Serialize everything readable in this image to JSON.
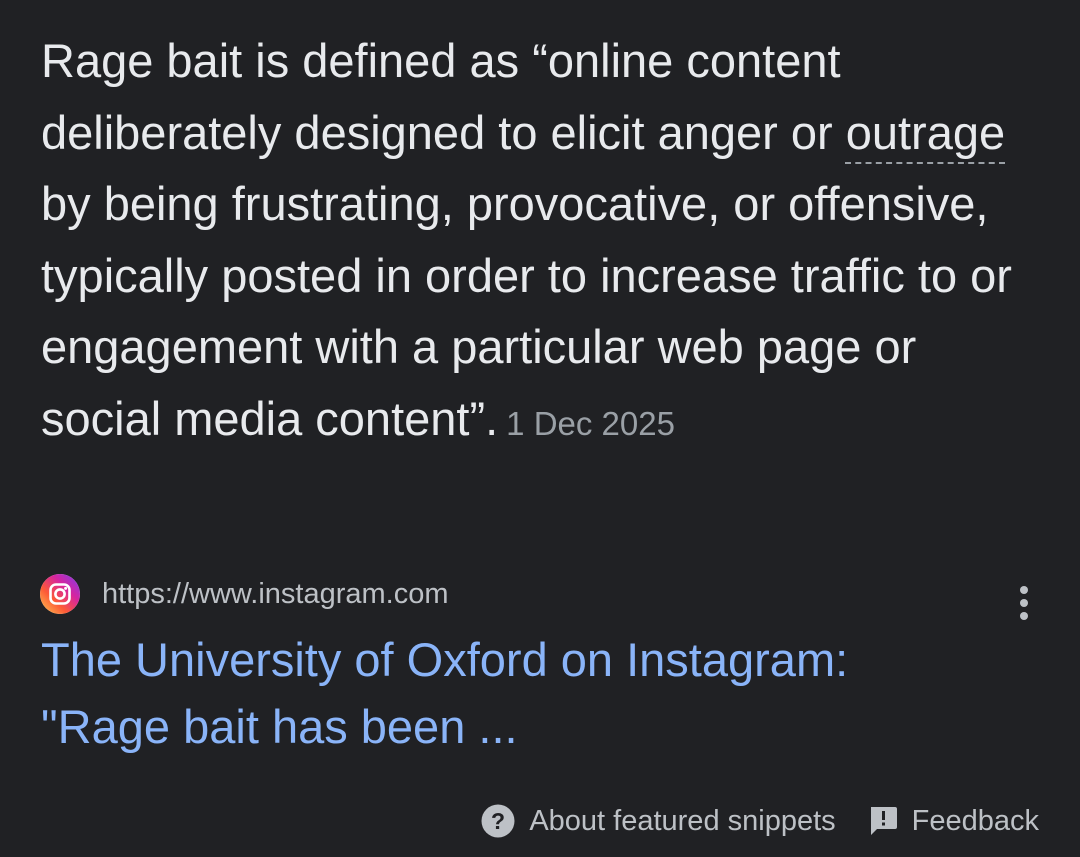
{
  "snippet": {
    "text_before": "Rage bait is defined as “online content deliberately designed to elicit anger or ",
    "term": "outrage",
    "text_after": " by being frustrating, provocative, or offensive, typically posted in order to increase traffic to or engagement with a particular web page or social media content”.",
    "date": "1 Dec 2025"
  },
  "source": {
    "favicon_icon": "instagram-icon",
    "url": "https://www.instagram.com",
    "more_icon": "more-vertical-icon"
  },
  "result": {
    "title_line1": "The University of Oxford on Instagram:",
    "title_line2": "\"Rage bait has been ..."
  },
  "footer": {
    "about_label": "About featured snippets",
    "about_icon": "help-circle-icon",
    "feedback_label": "Feedback",
    "feedback_icon": "feedback-icon"
  },
  "colors": {
    "background": "#202124",
    "text": "#e8eaed",
    "secondary_text": "#bdc1c6",
    "muted_text": "#9aa0a6",
    "link": "#8ab4f8"
  }
}
